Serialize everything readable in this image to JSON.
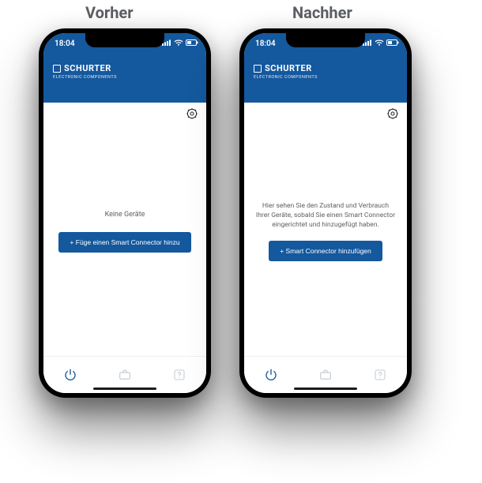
{
  "labels": {
    "before": "Vorher",
    "after": "Nachher"
  },
  "status": {
    "time": "18:04"
  },
  "brand": {
    "name": "SCHURTER",
    "subtitle": "ELECTRONIC COMPONENTS"
  },
  "before": {
    "message": "Keine Geräte",
    "cta": "+ Füge einen Smart Connector hinzu"
  },
  "after": {
    "message": "Hier sehen Sie den Zustand und Verbrauch Ihrer Geräte, sobald Sie einen Smart Connector eingerichtet und hinzugefügt haben.",
    "cta": "+ Smart Connector hinzufügen"
  },
  "colors": {
    "brand": "#14589e",
    "text_muted": "#5c5f63",
    "nav_inactive": "#c6cdd4"
  }
}
